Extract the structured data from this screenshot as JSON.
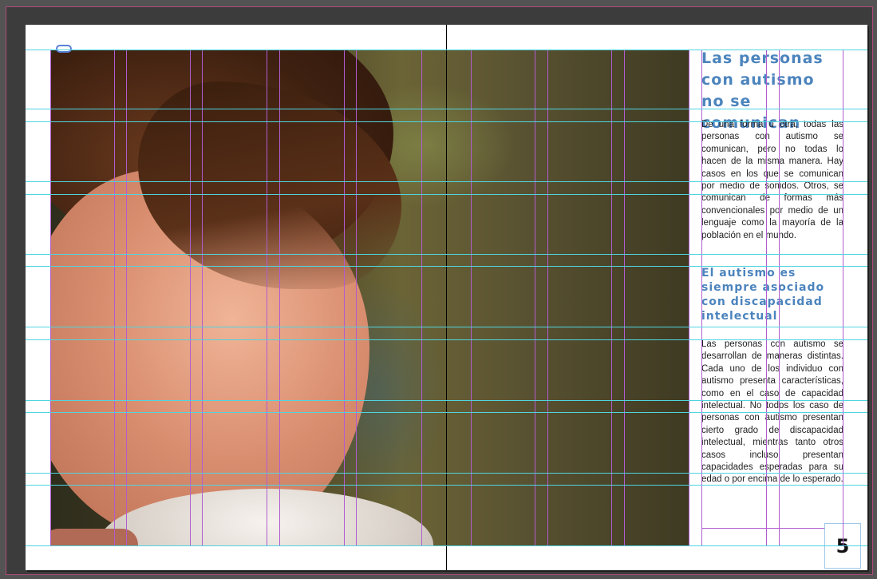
{
  "spread": {
    "page_number": "5",
    "section1": {
      "heading": "Las personas con autismo no se comunican",
      "body": "De una forma u otra, todas las personas con autismo se comunican, pero no todas lo hacen de la misma manera. Hay casos en los que se comunican por medio de sonidos. Otros, se comunican de formas más convencionales por medio de un lenguaje como la mayoría de la población en el mundo."
    },
    "section2": {
      "heading": "El autismo es siempre asociado con discapacidad intelectual",
      "body": "Las personas con autismo se desarrollan de maneras distintas. Cada uno de los individuo con autismo presenta características, como en el caso de capacidad intelectual. No todos los caso de personas con autismo presentan cierto grado de discapacidad intelectual, mientras tanto otros casos incluso presentan capacidades esperadas para su edad o por encima de lo esperado."
    }
  },
  "colors": {
    "pasteboard": "#3c3c3c",
    "heading": "#4c84bd",
    "column_guide": "#b05cd0",
    "ruler_guide": "#4fd4e0"
  }
}
